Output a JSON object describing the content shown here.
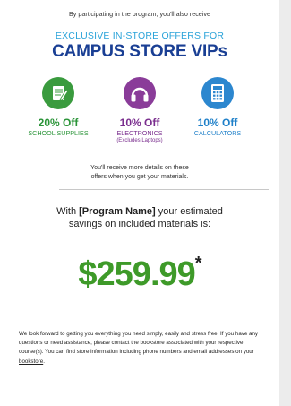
{
  "intro_text": "By participating in the program, you'll also receive",
  "headline_small": "EXCLUSIVE IN-STORE OFFERS FOR",
  "headline_big": "CAMPUS STORE VIPs",
  "offers": [
    {
      "icon": "notebook-pencil-icon",
      "color": "#3a9b3e",
      "percent": "20% Off",
      "category": "SCHOOL SUPPLIES",
      "note": ""
    },
    {
      "icon": "headphones-icon",
      "color": "#8a3c99",
      "percent": "10% Off",
      "category": "ELECTRONICS",
      "note": "(Excludes Laptops)"
    },
    {
      "icon": "calculator-icon",
      "color": "#2c87cf",
      "percent": "10% Off",
      "category": "CALCULATORS",
      "note": ""
    }
  ],
  "details_line1": "You'll receive more details on these",
  "details_line2": "offers when you get your materials.",
  "savings": {
    "prefix": "With",
    "program_name": "[Program Name]",
    "suffix": "your estimated",
    "line2": "savings on included materials is:",
    "amount": "$259.99",
    "asterisk": "*"
  },
  "footer": {
    "text": "We look forward to getting you everything you need simply, easily and stress free. If you have any questions or need assistance, please contact the bookstore associated with your respective course(s). You can find store information including phone numbers and email addresses on your",
    "link": "bookstore",
    "end": "."
  }
}
